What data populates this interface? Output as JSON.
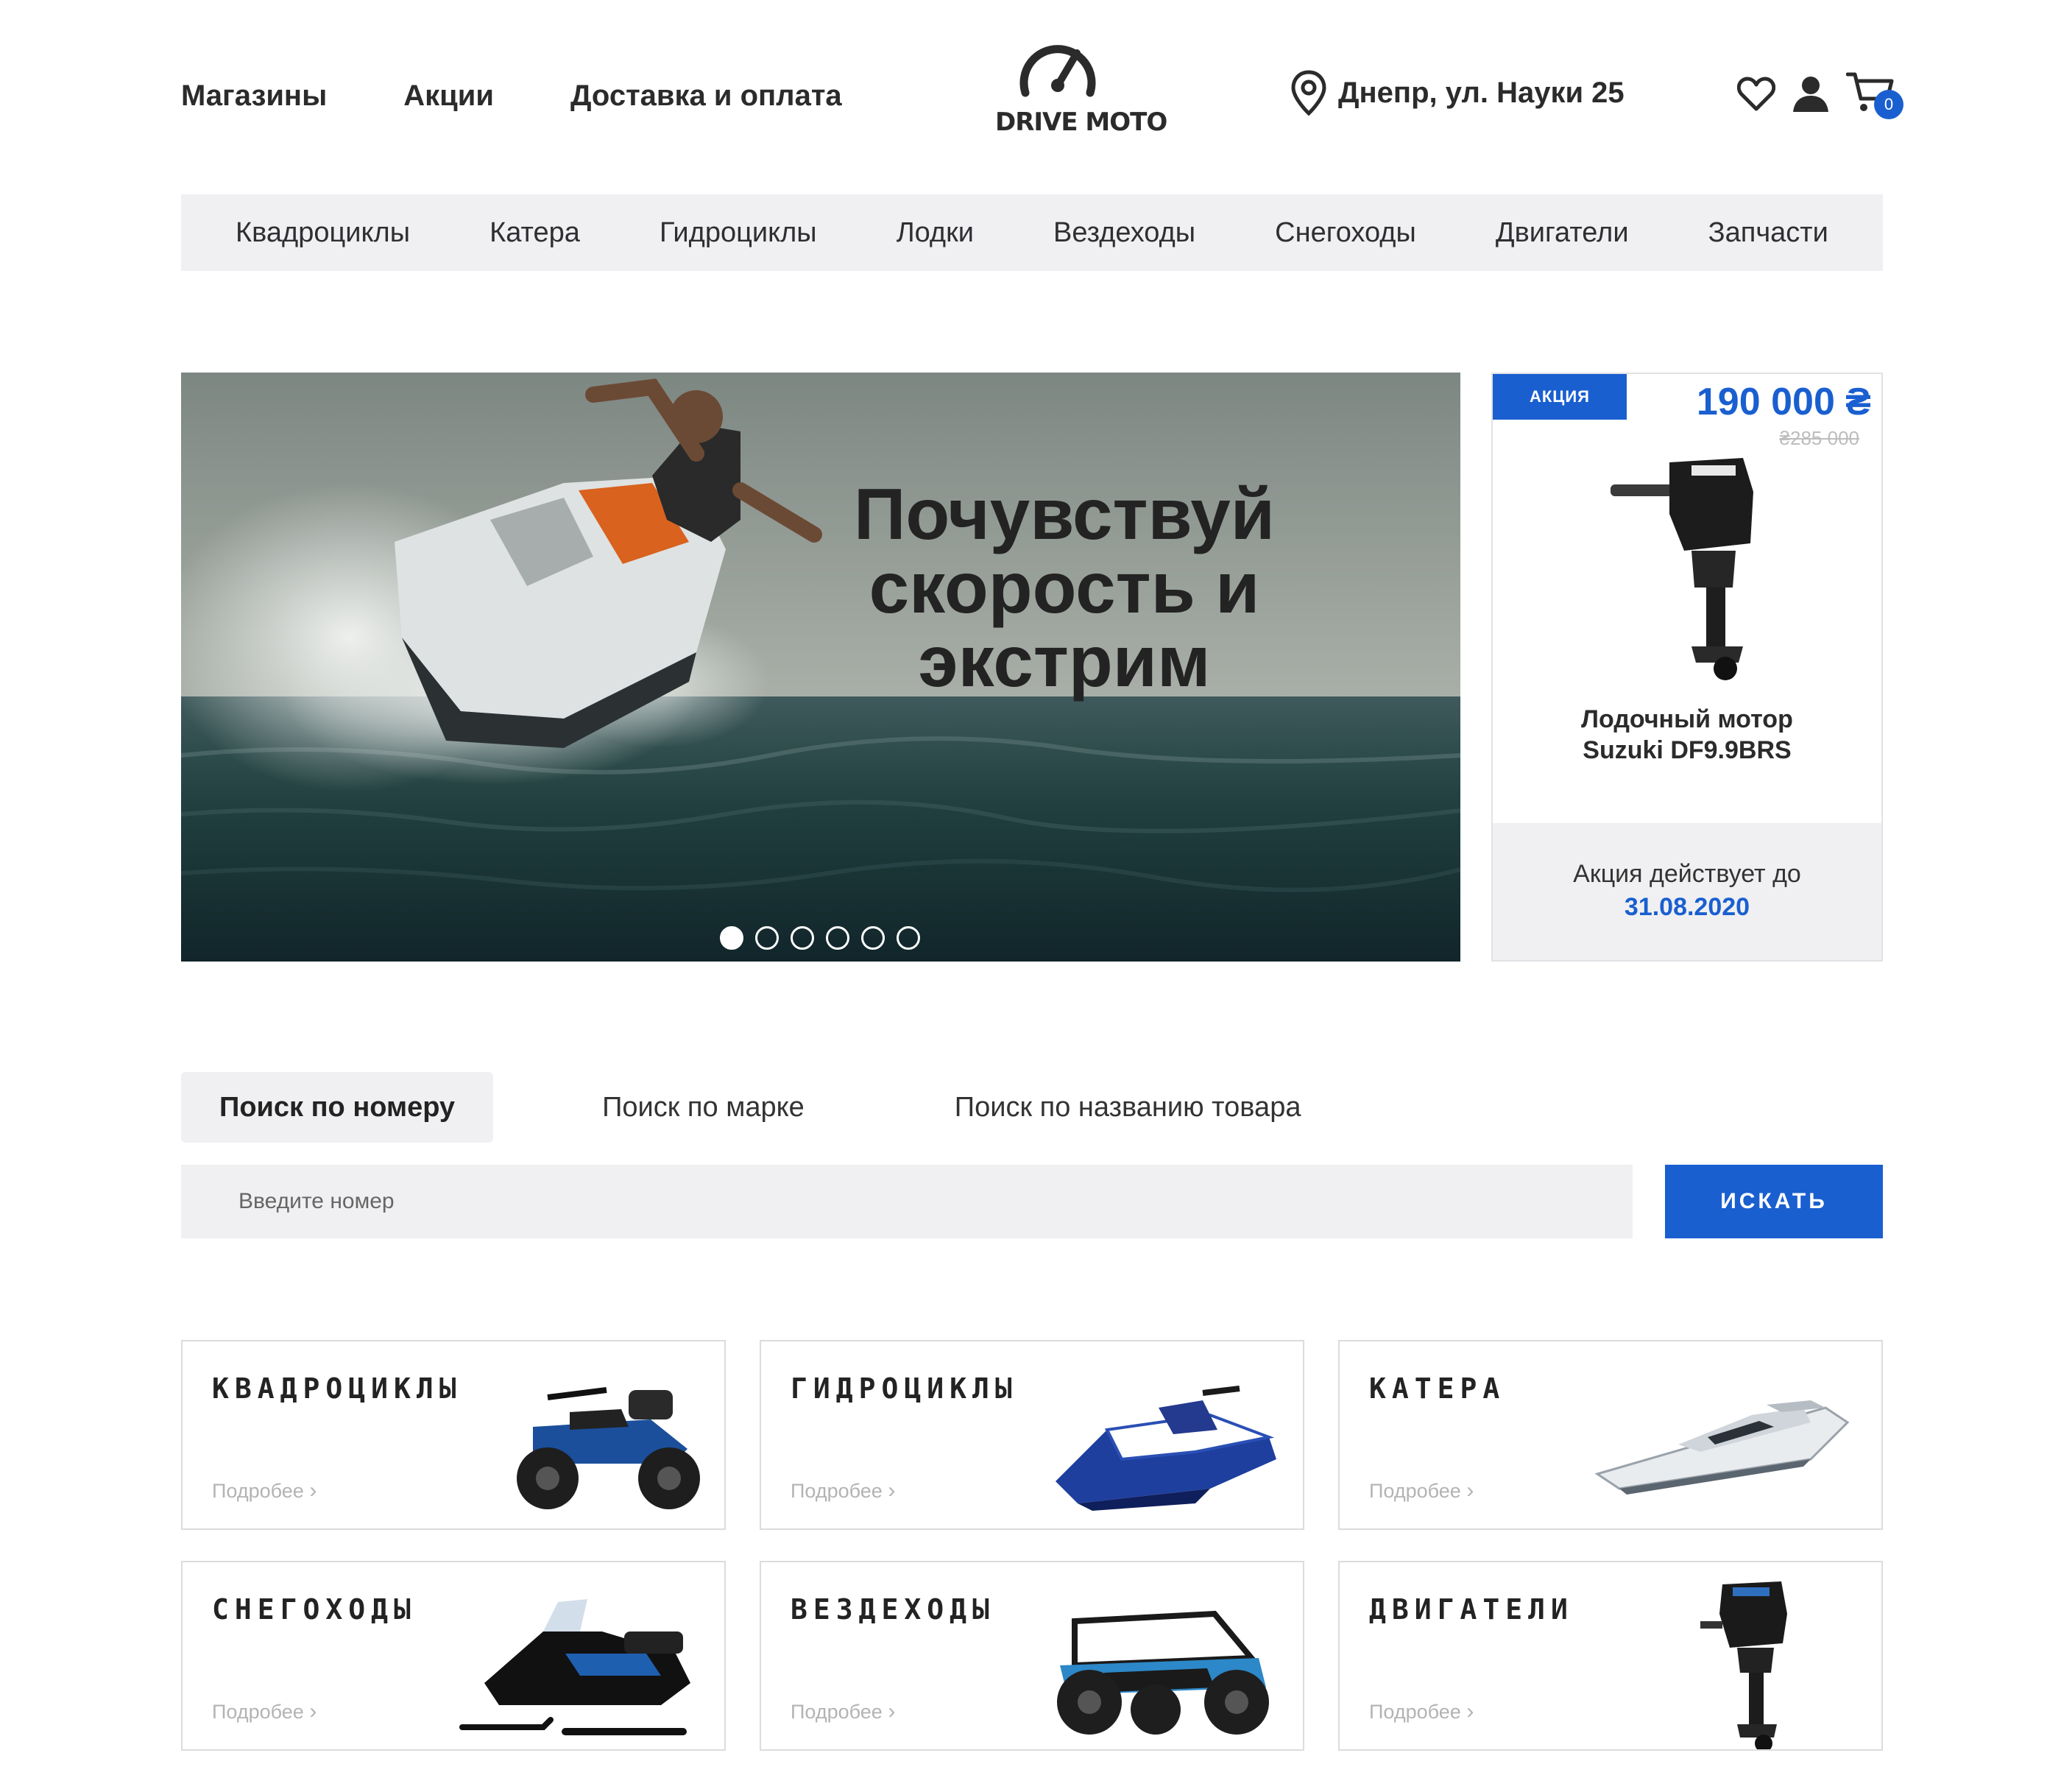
{
  "header": {
    "nav": [
      "Магазины",
      "Акции",
      "Доставка и оплата"
    ],
    "logo_text": "DRIVE MOTO",
    "address": "Днепр, ул. Науки 25",
    "cart_count": "0",
    "icons": [
      "heart-icon",
      "user-icon",
      "cart-icon",
      "location-pin-icon"
    ]
  },
  "categories_bar": [
    "Квадроциклы",
    "Катера",
    "Гидроциклы",
    "Лодки",
    "Вездеходы",
    "Снегоходы",
    "Двигатели",
    "Запчасти"
  ],
  "hero": {
    "lines": [
      "Почувствуй",
      "скорость и",
      "экстрим"
    ],
    "slides_total": 6,
    "active_slide": 1
  },
  "promo": {
    "badge": "АКЦИЯ",
    "price": "190 000 ₴",
    "old_price": "₴285 000",
    "title_line1": "Лодочный мотор",
    "title_line2": "Suzuki DF9.9BRS",
    "until_label": "Акция действует до",
    "until_date": "31.08.2020"
  },
  "search": {
    "tabs": [
      "Поиск по номеру",
      "Поиск по марке",
      "Поиск по названию товара"
    ],
    "active_tab": 0,
    "placeholder": "Введите номер",
    "button": "ИСКАТЬ"
  },
  "grid": {
    "more_label": "Подробее",
    "cards": [
      {
        "title": "КВАДРОЦИКЛЫ",
        "image": "atv"
      },
      {
        "title": "ГИДРОЦИКЛЫ",
        "image": "jetski"
      },
      {
        "title": "КАТЕРА",
        "image": "boat"
      },
      {
        "title": "СНЕГОХОДЫ",
        "image": "snowmobile"
      },
      {
        "title": "ВЕЗДЕХОДЫ",
        "image": "utv"
      },
      {
        "title": "ДВИГАТЕЛИ",
        "image": "outboard-motor"
      }
    ]
  },
  "colors": {
    "accent": "#1a5fd0",
    "panel": "#f0f0f2",
    "text": "#2b2b2b"
  }
}
